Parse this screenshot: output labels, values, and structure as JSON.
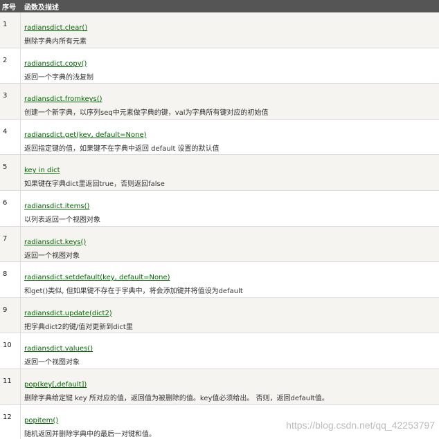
{
  "header": {
    "num_label": "序号",
    "desc_label": "函数及描述"
  },
  "rows": [
    {
      "num": "1",
      "func": "radiansdict.clear()",
      "desc": "删除字典内所有元素"
    },
    {
      "num": "2",
      "func": "radiansdict.copy()",
      "desc": "返回一个字典的浅复制"
    },
    {
      "num": "3",
      "func": "radiansdict.fromkeys()",
      "desc": "创建一个新字典，以序列seq中元素做字典的键，val为字典所有键对应的初始值"
    },
    {
      "num": "4",
      "func": "radiansdict.get(key, default=None)",
      "desc": "返回指定键的值，如果键不在字典中返回 default 设置的默认值"
    },
    {
      "num": "5",
      "func": "key in dict",
      "desc": "如果键在字典dict里返回true，否则返回false"
    },
    {
      "num": "6",
      "func": "radiansdict.items()",
      "desc": "以列表返回一个视图对象"
    },
    {
      "num": "7",
      "func": "radiansdict.keys()",
      "desc": "返回一个视图对象"
    },
    {
      "num": "8",
      "func": "radiansdict.setdefault(key, default=None)",
      "desc": "和get()类似, 但如果键不存在于字典中，将会添加键并将值设为default"
    },
    {
      "num": "9",
      "func": "radiansdict.update(dict2)",
      "desc": "把字典dict2的键/值对更新到dict里"
    },
    {
      "num": "10",
      "func": "radiansdict.values()",
      "desc": "返回一个视图对象"
    },
    {
      "num": "11",
      "func": "pop(key[,default])",
      "desc": "删除字典给定键 key 所对应的值，返回值为被删除的值。key值必须给出。 否则，返回default值。"
    },
    {
      "num": "12",
      "func": "popitem()",
      "desc": "随机返回并删除字典中的最后一对键和值。"
    }
  ],
  "watermark": "https://blog.csdn.net/qq_42253797",
  "colors": {
    "header_bg": "#555555",
    "link": "#006600",
    "row_alt_bg": "#f6f4f0"
  }
}
